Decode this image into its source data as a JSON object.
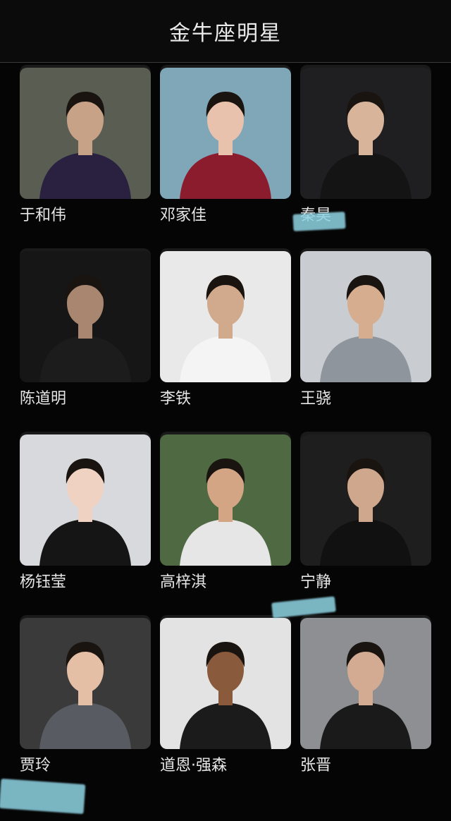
{
  "header": {
    "title": "金牛座明星"
  },
  "stars": [
    {
      "name": "于和伟",
      "portrait_icon": "man-in-suit-portrait",
      "bg": "#5a5d52",
      "top": "#2a2040",
      "skin": "#c8a287"
    },
    {
      "name": "邓家佳",
      "portrait_icon": "woman-in-red-dress-portrait",
      "bg": "#7fa7b8",
      "top": "#8a1c2e",
      "skin": "#e8c2ac"
    },
    {
      "name": "秦昊",
      "portrait_icon": "man-in-leather-jacket-portrait",
      "bg": "#1f1f22",
      "top": "#141414",
      "skin": "#d8b49a"
    },
    {
      "name": "陈道明",
      "portrait_icon": "man-in-black-portrait",
      "bg": "#161616",
      "top": "#1c1c1c",
      "skin": "#a88670"
    },
    {
      "name": "李铁",
      "portrait_icon": "man-in-white-jersey-portrait",
      "bg": "#e9e9e9",
      "top": "#f4f4f4",
      "skin": "#d1a98c"
    },
    {
      "name": "王骁",
      "portrait_icon": "man-in-grey-blazer-portrait",
      "bg": "#c9cdd2",
      "top": "#8f959c",
      "skin": "#d7ad90"
    },
    {
      "name": "杨钰莹",
      "portrait_icon": "woman-in-black-suit-portrait",
      "bg": "#d8d9dc",
      "top": "#151515",
      "skin": "#efd2c2"
    },
    {
      "name": "高梓淇",
      "portrait_icon": "man-close-up-portrait",
      "bg": "#4f6a42",
      "top": "#e6e6e6",
      "skin": "#d3a585"
    },
    {
      "name": "宁静",
      "portrait_icon": "woman-close-up-portrait",
      "bg": "#1e1e1e",
      "top": "#111111",
      "skin": "#cfa78d"
    },
    {
      "name": "贾玲",
      "portrait_icon": "woman-in-sweater-portrait",
      "bg": "#3a3a3a",
      "top": "#585b62",
      "skin": "#e4bfa6"
    },
    {
      "name": "道恩·强森",
      "portrait_icon": "man-in-black-tee-portrait",
      "bg": "#e3e3e3",
      "top": "#1b1b1b",
      "skin": "#8a5a3c"
    },
    {
      "name": "张晋",
      "portrait_icon": "man-in-dark-suit-portrait",
      "bg": "#8d8f92",
      "top": "#1a1a1a",
      "skin": "#d3ab92"
    }
  ]
}
